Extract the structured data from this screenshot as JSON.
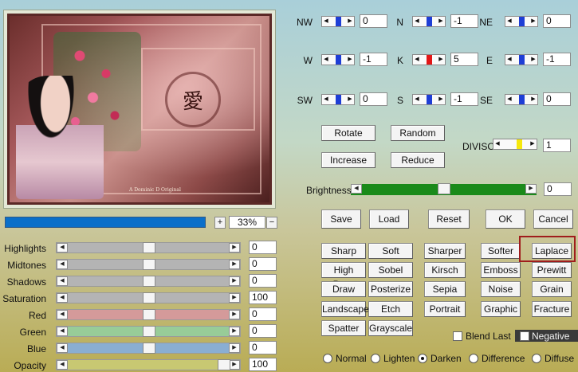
{
  "preview": {
    "emblem_glyph": "愛",
    "watermark": "A Dominic D Original"
  },
  "zoom": {
    "plus_label": "+",
    "minus_label": "−",
    "value": "33%",
    "progress": 1.0
  },
  "sliders": [
    {
      "label": "Highlights",
      "value": "0",
      "position": 0.5,
      "color": "#b4b4b4"
    },
    {
      "label": "Midtones",
      "value": "0",
      "position": 0.5,
      "color": "#b4b4b4"
    },
    {
      "label": "Shadows",
      "value": "0",
      "position": 0.5,
      "color": "#b4b4b4"
    },
    {
      "label": "Saturation",
      "value": "100",
      "position": 0.5,
      "color": "#b4b4b4"
    },
    {
      "label": "Red",
      "value": "0",
      "position": 0.5,
      "color": "#d49a9a"
    },
    {
      "label": "Green",
      "value": "0",
      "position": 0.5,
      "color": "#98cc98"
    },
    {
      "label": "Blue",
      "value": "0",
      "position": 0.5,
      "color": "#8aaed2"
    },
    {
      "label": "Opacity",
      "value": "100",
      "position": 1.0,
      "color": "#c8c872"
    }
  ],
  "neighbors": [
    {
      "label": "NW",
      "value": "0"
    },
    {
      "label": "N",
      "value": "-1"
    },
    {
      "label": "NE",
      "value": "0"
    },
    {
      "label": "W",
      "value": "-1"
    },
    {
      "label": "K",
      "value": "5"
    },
    {
      "label": "E",
      "value": "-1"
    },
    {
      "label": "SW",
      "value": "0"
    },
    {
      "label": "S",
      "value": "-1"
    },
    {
      "label": "SE",
      "value": "0"
    }
  ],
  "matrix_buttons": {
    "rotate": "Rotate",
    "random": "Random",
    "increase": "Increase",
    "reduce": "Reduce"
  },
  "divisor": {
    "label": "DIVISOR",
    "value": "1"
  },
  "brightness": {
    "label": "Brightness",
    "value": "0"
  },
  "actions": {
    "save": "Save",
    "load": "Load",
    "reset": "Reset",
    "ok": "OK",
    "cancel": "Cancel"
  },
  "presets": [
    [
      "Sharp",
      "Soft",
      "Sharper",
      "Softer",
      "Laplace"
    ],
    [
      "High Pass",
      "Sobel",
      "Kirsch",
      "Emboss",
      "Prewitt"
    ],
    [
      "Draw",
      "Posterize",
      "Sepia",
      "Noise",
      "Grain"
    ],
    [
      "Landscape",
      "Etch",
      "Portrait",
      "Graphic",
      "Fracture"
    ],
    [
      "Spatter",
      "Grayscale"
    ]
  ],
  "options": {
    "blend_last": "Blend Last",
    "negative": "Negative"
  },
  "blend_modes": [
    {
      "label": "Normal",
      "selected": false
    },
    {
      "label": "Lighten",
      "selected": false
    },
    {
      "label": "Darken",
      "selected": true
    },
    {
      "label": "Difference",
      "selected": false
    },
    {
      "label": "Diffuse",
      "selected": false
    }
  ],
  "colors": {
    "progress": "#0a6fc9",
    "brightness_track": "#1a8a1a",
    "divisor_marker": "#f6e80c",
    "center_marker": "#e21616",
    "neighbor_marker": "#1e3ed6",
    "highlight_border": "#a01c1c"
  }
}
